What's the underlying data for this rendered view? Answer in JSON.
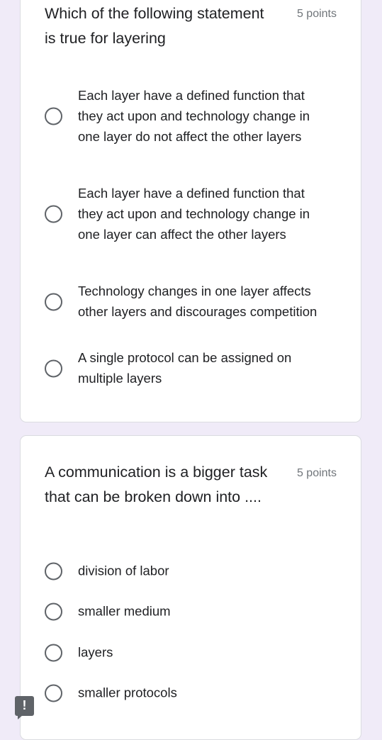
{
  "questions": [
    {
      "title": "Which of the following statement is true for layering",
      "points": "5 points",
      "options": [
        {
          "label": "Each layer have a defined function that they act upon and technology change in one layer do not affect the other layers"
        },
        {
          "label": "Each layer have a defined function that they act upon and technology change in one layer can affect the other layers"
        },
        {
          "label": "Technology changes in one layer affects other layers and discourages competition"
        },
        {
          "label": "A single protocol can be assigned on multiple layers"
        }
      ]
    },
    {
      "title": "A communication is a bigger task that can be broken down into ....",
      "points": "5 points",
      "options": [
        {
          "label": "division of labor"
        },
        {
          "label": "smaller medium"
        },
        {
          "label": "layers"
        },
        {
          "label": "smaller protocols"
        }
      ]
    }
  ],
  "feedback_button": {
    "icon": "report-issue-icon",
    "glyph": "!"
  },
  "colors": {
    "page_background": "#f0ebf8",
    "card_background": "#ffffff",
    "text": "#202124",
    "muted_text": "#70757a",
    "radio_border": "#5f6368"
  }
}
